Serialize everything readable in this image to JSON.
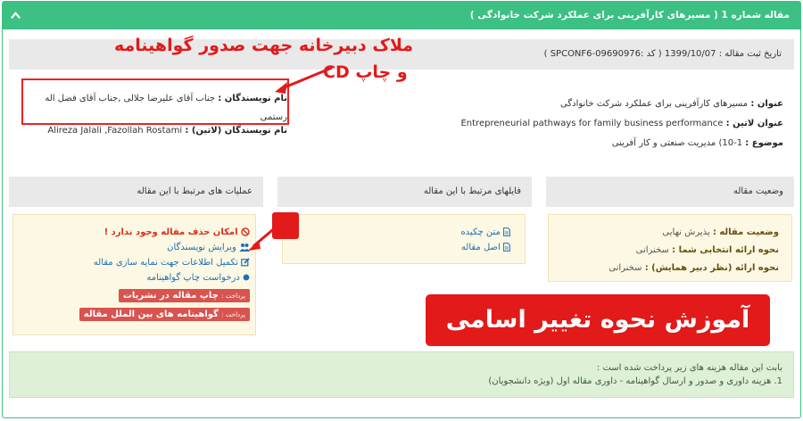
{
  "header": {
    "title": "مقاله شماره 1 ( مسیرهای کارآفرینی برای عملکرد شرکت خانوادگی )"
  },
  "registration": {
    "text": "تاریخ ثبت مقاله : 1399/10/07 ( کد :SPCONF6-09690976 )"
  },
  "article": {
    "title_label": "عنوان :",
    "title_value": "مسیرهای کارآفرینی برای عملکرد شرکت خانوادگی",
    "latin_title_label": "عنوان لاتین :",
    "latin_title_value": "Entrepreneurial pathways for family business performance",
    "subject_label": "موضوع :",
    "subject_value": "1-10) مدیریت صنعتی و کار آفرینی"
  },
  "authors": {
    "label": "نام نویسندگان :",
    "value": "جناب آقای علیرضا جلالی ,جناب آقای فضل اله رستمی",
    "latin_label": "نام نویسندگان (لاتین) :",
    "latin_value": "Alireza Jalali ,Fazollah Rostami"
  },
  "annotations": {
    "criteria_line1": "ملاک دبیرخانه جهت صدور گواهینامه",
    "criteria_line2": "و چاپ CD",
    "banner": "آموزش نحوه تغییر اسامی"
  },
  "panels": {
    "operations_title": "عملیات های مرتبط با این مقاله",
    "files_title": "فایلهای مرتبط با این مقاله",
    "status_title": "وضعیت مقاله"
  },
  "operations": {
    "warning": "امکان حذف مقاله وجود ندارد !",
    "edit_authors": "ویرایش نویسندگان",
    "complete_index": "تکمیل اطلاعات جهت نمایه سازی مقاله",
    "request_print": "درخواست چاپ گواهینامه",
    "paid_prefix": "پرداخت :",
    "paid_print": "چاپ مقاله در نشریات",
    "paid_intl": "گواهینامه های بین الملل مقاله"
  },
  "files": {
    "abstract": "متن چکیده",
    "original": "اصل مقاله"
  },
  "status": {
    "status_label": "وضعیت مقاله :",
    "status_value": "پذیرش نهایی",
    "presentation_label": "نحوه ارائه انتخابی شما :",
    "presentation_value": "سخنرانی",
    "presentation_reviewer_label": "نحوه ارائه (نظر دبیر همایش) :",
    "presentation_reviewer_value": "سخنرانی"
  },
  "payment": {
    "intro": "بابت این مقاله هزینه های زیر پرداخت شده است :",
    "item1": "1. هزینه داوری و صدور و ارسال گواهینامه - داوری مقاله اول (ویژه دانشجویان)"
  },
  "colors": {
    "header_green": "#3cc083",
    "annotation_red": "#e21a1a",
    "panel_yellow": "#fcf8e3",
    "payment_green": "#dff0d8",
    "link_blue": "#1b6fb5"
  }
}
